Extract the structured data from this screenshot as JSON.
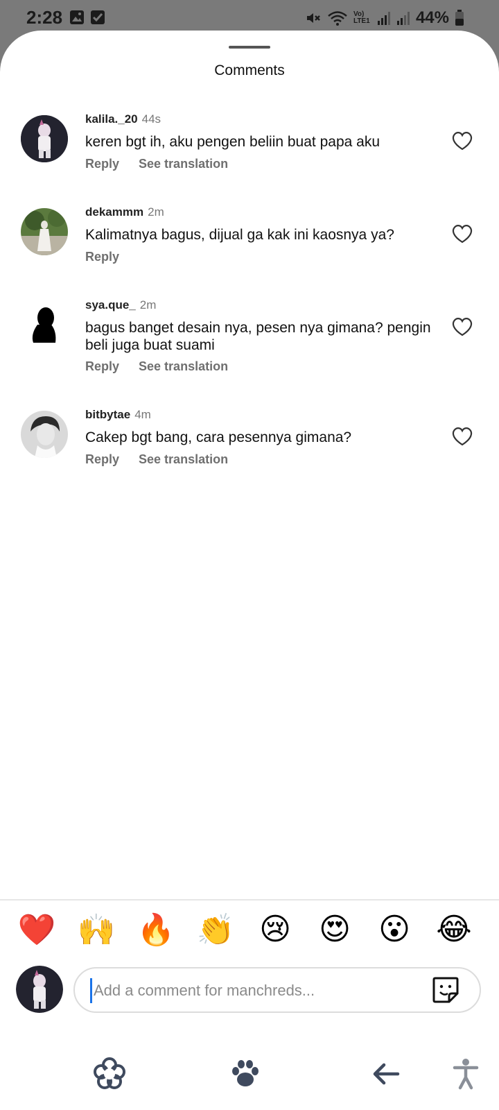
{
  "status_bar": {
    "time": "2:28",
    "battery": "44%",
    "network": "Vo) LTE1"
  },
  "sheet": {
    "title": "Comments"
  },
  "comments": [
    {
      "username": "kalila._20",
      "time": "44s",
      "text": "keren bgt ih, aku pengen beliin buat papa aku",
      "reply_label": "Reply",
      "translate_label": "See translation"
    },
    {
      "username": "dekammm",
      "time": "2m",
      "text": "Kalimatnya bagus, dijual ga kak ini kaosnya ya?",
      "reply_label": "Reply",
      "translate_label": ""
    },
    {
      "username": "sya.que_",
      "time": "2m",
      "text": "bagus banget desain nya, pesen nya gimana? pengin beli juga buat suami",
      "reply_label": "Reply",
      "translate_label": "See translation"
    },
    {
      "username": "bitbytae",
      "time": "4m",
      "text": "Cakep bgt bang, cara pesennya gimana?",
      "reply_label": "Reply",
      "translate_label": "See translation"
    }
  ],
  "emojis": [
    "❤️",
    "🙌",
    "🔥",
    "👏",
    "😢",
    "😍",
    "😮",
    "😂"
  ],
  "composer": {
    "placeholder": "Add a comment for manchreds..."
  },
  "icons": {
    "heart": "heart-outline-icon",
    "sticker": "sticker-icon",
    "nav_left": "flower-icon",
    "nav_center": "paw-icon",
    "nav_back": "back-arrow-icon",
    "nav_accessibility": "accessibility-icon"
  },
  "colors": {
    "status_bar_bg": "#7a7a7a",
    "sheet_bg": "#ffffff",
    "secondary_text": "#6f6f6f",
    "cursor": "#1a73e8",
    "nav_icon": "#3f4a5e"
  }
}
